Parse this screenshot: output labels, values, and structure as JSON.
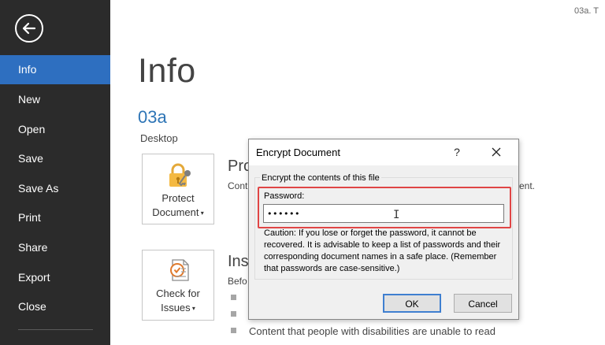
{
  "file": {
    "name": "03a. T"
  },
  "nav": {
    "items": [
      {
        "label": "Info"
      },
      {
        "label": "New"
      },
      {
        "label": "Open"
      },
      {
        "label": "Save"
      },
      {
        "label": "Save As"
      },
      {
        "label": "Print"
      },
      {
        "label": "Share"
      },
      {
        "label": "Export"
      },
      {
        "label": "Close"
      }
    ],
    "active": "Info",
    "accent": "#2e6fc0",
    "background": "#2b2b2b"
  },
  "page": {
    "title": "Info",
    "doc_name": "03a",
    "location": "Desktop"
  },
  "protect": {
    "button_line1": "Protect",
    "button_line2": "Document",
    "title_fragment": "Pro",
    "desc_fragment": "Cont",
    "desc_tail": "ent."
  },
  "inspect": {
    "button_line1": "Check for",
    "button_line2": "Issues",
    "title_fragment": "Ins",
    "desc_fragment": "Befo",
    "bullet_text": "Content that people with disabilities are unable to read"
  },
  "dialog": {
    "title": "Encrypt Document",
    "help": "?",
    "group_label": "Encrypt the contents of this file",
    "password_label": "Password:",
    "password_value": "••••••",
    "caution": "Caution: If you lose or forget the password, it cannot be recovered. It is advisable to keep a list of passwords and their corresponding document names in a safe place. (Remember that passwords are case-sensitive.)",
    "ok": "OK",
    "cancel": "Cancel",
    "highlight_color": "#e04545"
  }
}
